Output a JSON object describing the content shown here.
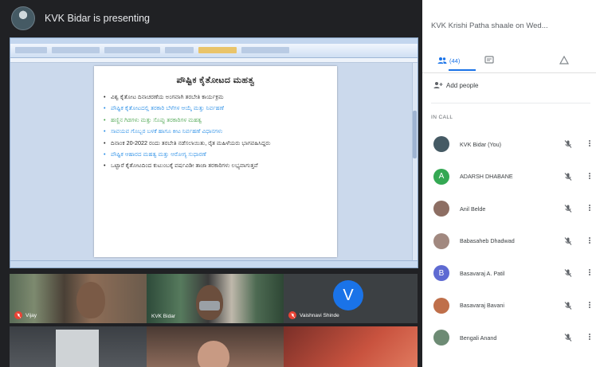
{
  "meeting": {
    "presenter_text": "KVK Bidar is presenting",
    "shared_doc": {
      "heading": "ಪೌಷ್ಟಿಕ ಕೈತೋಟದ ಮಹತ್ವ",
      "lines": [
        {
          "text": "ವಿಶ್ವ ಕೈತೋಟ ದಿನಾಚರಣೆಯ ಅಂಗವಾಗಿ ತರಬೇತಿ ಕಾರ್ಯಕ್ರಮ",
          "color": "#222222"
        },
        {
          "text": "ಪೌಷ್ಟಿಕ ಕೈತೋಟದಲ್ಲಿ ತರಕಾರಿ ಬೆಳೆಗಳ ಆಯ್ಕೆ ಮತ್ತು ನಿರ್ವಹಣೆ",
          "color": "#1e88e5"
        },
        {
          "text": "ಹಣ್ಣಿನ ಗಿಡಗಳು ಮತ್ತು ಸೊಪ್ಪು ತರಕಾರಿಗಳ ಮಹತ್ವ",
          "color": "#43a047"
        },
        {
          "text": "ಸಾವಯವ ಗೊಬ್ಬರ ಬಳಕೆ ಹಾಗೂ ಕೀಟ ನಿರ್ವಹಣೆ ವಿಧಾನಗಳು",
          "color": "#1e88e5"
        },
        {
          "text": "ದಿನಾಂಕ 20-2022 ರಂದು ತರಬೇತಿ ನಡೆಸಲಾಯಿತು, ರೈತ ಮಹಿಳೆಯರು ಭಾಗವಹಿಸಿದ್ದರು",
          "color": "#222222"
        },
        {
          "text": "ಪೌಷ್ಟಿಕ ಆಹಾರದ ಮಹತ್ವ ಮತ್ತು ಆರೋಗ್ಯ ಸುಧಾರಣೆ",
          "color": "#1e88e5"
        },
        {
          "text": "ಒಟ್ಟಾರೆ ಕೈತೋಟದಿಂದ ಕುಟುಂಬಕ್ಕೆ ವರ್ಷವಿಡೀ ತಾಜಾ ತರಕಾರಿಗಳು ಲಭ್ಯವಾಗುತ್ತವೆ",
          "color": "#222222"
        }
      ]
    },
    "tiles": [
      {
        "name": "Vijay"
      },
      {
        "name": "KVK Bidar"
      },
      {
        "name": "Vaishnavi Shinde",
        "initial": "V"
      },
      {
        "name": ""
      },
      {
        "name": ""
      },
      {
        "name": ""
      }
    ]
  },
  "panel": {
    "meeting_title": "KVK Krishi Patha shaale on Wed...",
    "tabs": {
      "people": "(44)"
    },
    "add_people": "Add people",
    "section_header": "IN CALL",
    "participants": [
      {
        "name": "KVK Bidar (You)",
        "initial": "",
        "color": "#455a64"
      },
      {
        "name": "ADARSH DHABANE",
        "initial": "A",
        "color": "#34a853"
      },
      {
        "name": "Anil Belde",
        "initial": "",
        "color": "#8d6e63"
      },
      {
        "name": "Babasaheb Dhadwad",
        "initial": "",
        "color": "#a1887f"
      },
      {
        "name": "Basavaraj A. Patil",
        "initial": "B",
        "color": "#5e6ad2"
      },
      {
        "name": "Basavaraj Bavani",
        "initial": "",
        "color": "#bf6f4a"
      },
      {
        "name": "Bengali Anand",
        "initial": "",
        "color": "#6d8b74"
      }
    ]
  }
}
